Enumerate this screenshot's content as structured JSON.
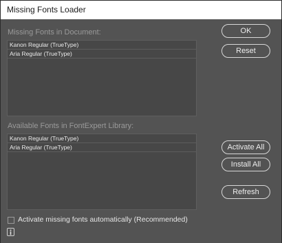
{
  "window": {
    "title": "Missing Fonts Loader"
  },
  "missing_section": {
    "label": "Missing Fonts in Document:",
    "items": [
      "Kanon Regular (TrueType)",
      "Aria Regular (TrueType)"
    ]
  },
  "available_section": {
    "label": "Available Fonts in FontExpert Library:",
    "items": [
      "Kanon Regular (TrueType)",
      "Aria Regular (TrueType)"
    ]
  },
  "buttons": {
    "ok": "OK",
    "reset": "Reset",
    "activate_all": "Activate All",
    "install_all": "Install All",
    "refresh": "Refresh"
  },
  "auto_activate": {
    "label": "Activate missing fonts automatically (Recommended)",
    "checked": false
  },
  "icons": {
    "info": "info-icon"
  }
}
